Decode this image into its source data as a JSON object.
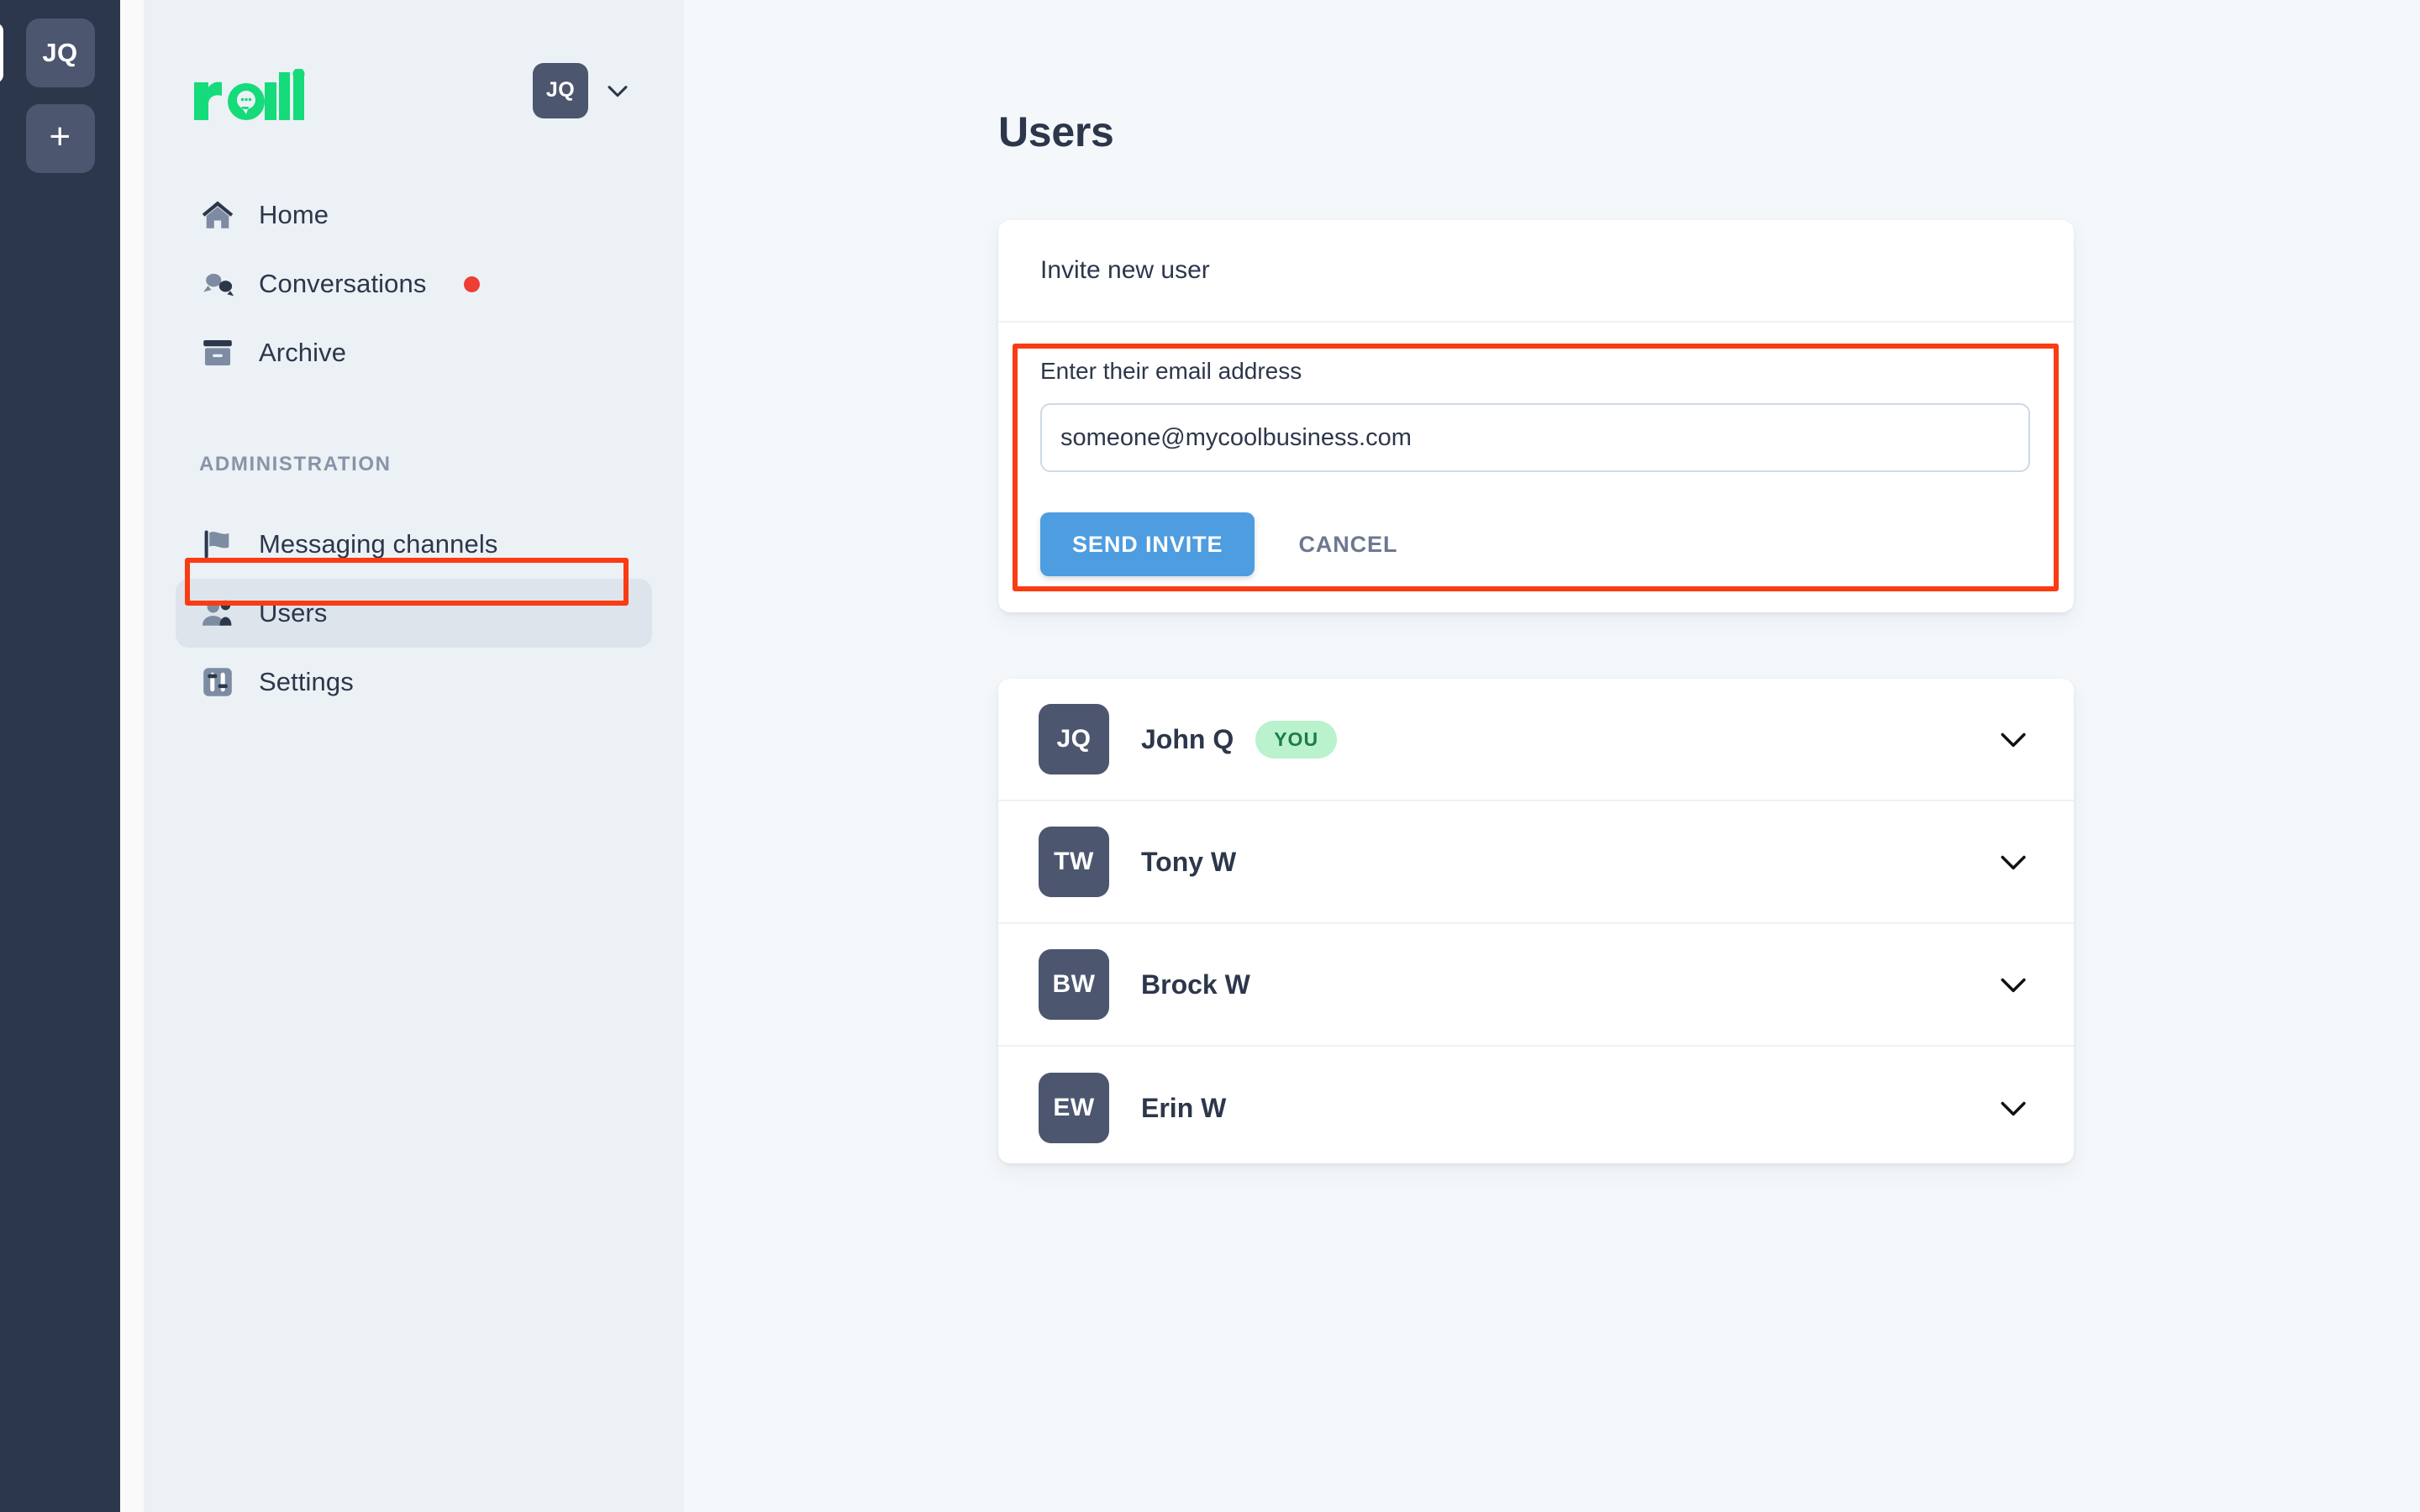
{
  "rail": {
    "account_initials": "JQ",
    "add_label": "+",
    "add_icon": "plus-icon"
  },
  "sidebar": {
    "brand": "ralli",
    "profile": {
      "initials": "JQ",
      "chevron_icon": "chevron-down-icon"
    },
    "nav": [
      {
        "label": "Home",
        "icon": "home-icon",
        "selected": false,
        "badge": false
      },
      {
        "label": "Conversations",
        "icon": "chat-bubbles-icon",
        "selected": false,
        "badge": true
      },
      {
        "label": "Archive",
        "icon": "archive-box-icon",
        "selected": false,
        "badge": false
      }
    ],
    "section_title": "ADMINISTRATION",
    "admin_nav": [
      {
        "label": "Messaging channels",
        "icon": "flag-icon",
        "selected": false
      },
      {
        "label": "Users",
        "icon": "users-icon",
        "selected": true
      },
      {
        "label": "Settings",
        "icon": "sliders-icon",
        "selected": false
      }
    ]
  },
  "main": {
    "page_title": "Users",
    "invite_card": {
      "header": "Invite new user",
      "field_label": "Enter their email address",
      "email_value": "someone@mycoolbusiness.com",
      "email_placeholder": "someone@mycoolbusiness.com",
      "send_label": "SEND INVITE",
      "cancel_label": "CANCEL"
    },
    "users": [
      {
        "initials": "JQ",
        "name": "John Q",
        "badge": "YOU",
        "chevron_icon": "chevron-down-icon"
      },
      {
        "initials": "TW",
        "name": "Tony W",
        "badge": "",
        "chevron_icon": "chevron-down-icon"
      },
      {
        "initials": "BW",
        "name": "Brock W",
        "badge": "",
        "chevron_icon": "chevron-down-icon"
      },
      {
        "initials": "EW",
        "name": "Erin W",
        "badge": "",
        "chevron_icon": "chevron-down-icon"
      }
    ]
  },
  "annotations": {
    "highlight_color": "#f93c13",
    "boxes": [
      "users-nav-item",
      "invite-form"
    ]
  },
  "colors": {
    "rail_bg": "#2d374b",
    "sidebar_bg": "#ecf1f5",
    "main_bg": "#f4f8fb",
    "brand_green": "#15db7a",
    "primary_button": "#4d9de0",
    "badge_green_bg": "#b9f2cd",
    "badge_green_text": "#1f7a4d",
    "notification_red": "#ef3e36",
    "avatar_bg": "#4c566f",
    "text_dark": "#2d374b"
  }
}
